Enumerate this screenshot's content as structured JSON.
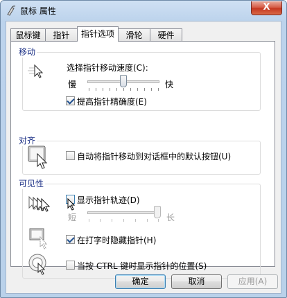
{
  "window": {
    "title": "鼠标 属性",
    "close": "X"
  },
  "tabs": [
    "鼠标键",
    "指针",
    "指针选项",
    "滑轮",
    "硬件"
  ],
  "active_tab": "指针选项",
  "motion": {
    "group_label": "移动",
    "speed_label": "选择指针移动速度(C):",
    "slow": "慢",
    "fast": "快",
    "speed_level_fraction": 0.5,
    "precision_label": "提高指针精确度(E)",
    "precision_checked": true
  },
  "snap": {
    "group_label": "对齐",
    "snap_label": "自动将指针移动到对话框中的默认按钮(U)",
    "snap_checked": false
  },
  "visibility": {
    "group_label": "可见性",
    "trails_label": "显示指针轨迹(D)",
    "trails_checked": false,
    "short": "短",
    "long": "长",
    "trails_level_fraction": 1.0,
    "hide_label": "在打字时隐藏指针(H)",
    "hide_checked": true,
    "ctrl_label": "当按 CTRL 键时显示指针的位置(S)",
    "ctrl_checked": false
  },
  "buttons": {
    "ok": "确定",
    "cancel": "取消",
    "apply": "应用(A)"
  },
  "icons": [
    "mouse-app-icon",
    "pointer-speed-icon",
    "snap-to-icon",
    "pointer-trails-icon",
    "hide-while-typing-icon",
    "ctrl-locate-icon"
  ]
}
